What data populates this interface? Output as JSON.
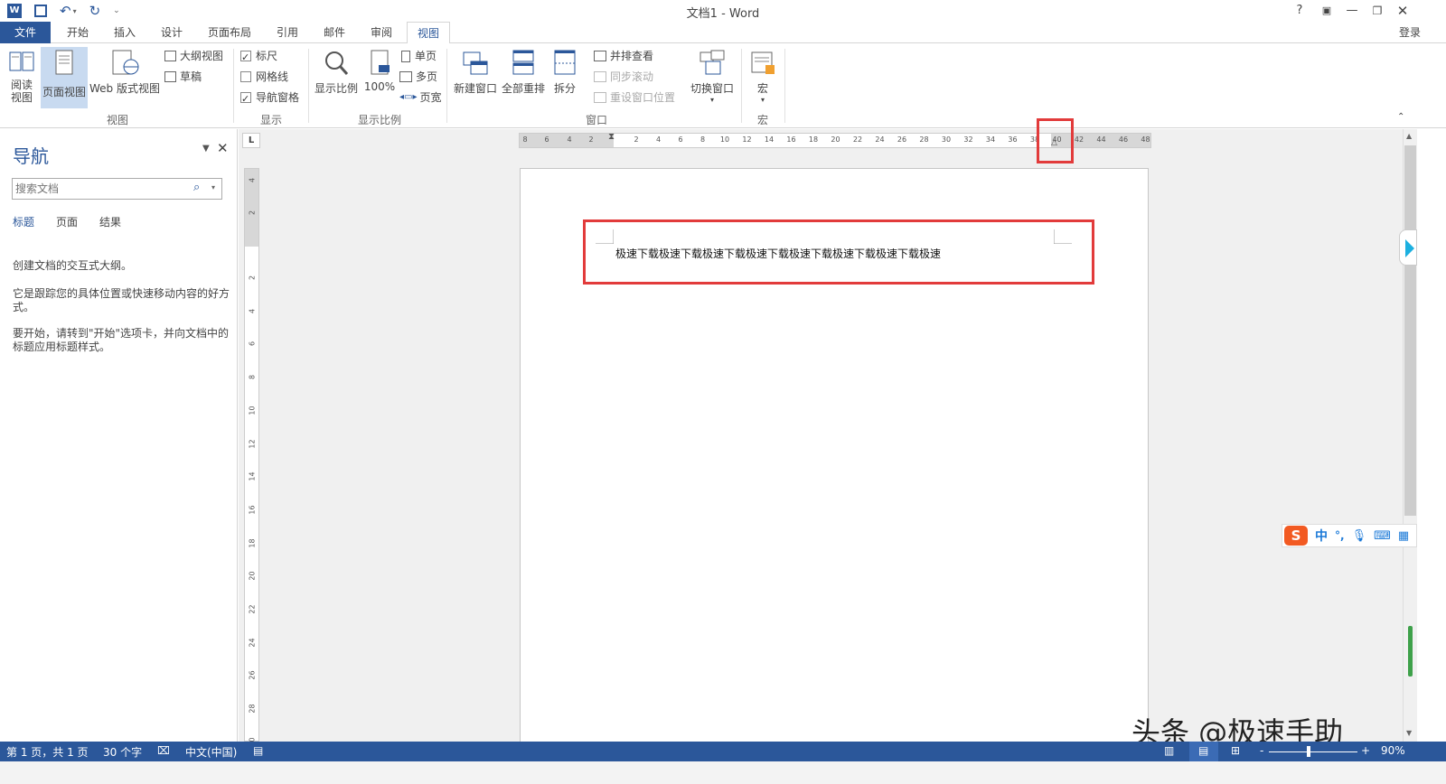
{
  "window": {
    "title": "文档1 - Word",
    "help": "?",
    "login": "登录"
  },
  "tabs": [
    {
      "label": "文件"
    },
    {
      "label": "开始"
    },
    {
      "label": "插入"
    },
    {
      "label": "设计"
    },
    {
      "label": "页面布局"
    },
    {
      "label": "引用"
    },
    {
      "label": "邮件"
    },
    {
      "label": "审阅"
    },
    {
      "label": "视图"
    }
  ],
  "ribbon": {
    "views": {
      "read": "阅读\n视图",
      "print_layout": "页面视图",
      "web": "Web 版式视图",
      "outline": "大纲视图",
      "draft": "草稿",
      "group": "视图"
    },
    "show": {
      "ruler": "标尺",
      "ruler_checked": true,
      "gridlines": "网格线",
      "gridlines_checked": false,
      "nav_pane": "导航窗格",
      "nav_pane_checked": true,
      "group": "显示"
    },
    "zoom": {
      "zoom": "显示比例",
      "hundred": "100%",
      "one_page": "单页",
      "multi_page": "多页",
      "page_width": "页宽",
      "group": "显示比例"
    },
    "window": {
      "new_window": "新建窗口",
      "arrange_all": "全部重排",
      "split": "拆分",
      "side_by_side": "并排查看",
      "sync_scroll": "同步滚动",
      "reset_position": "重设窗口位置",
      "switch_windows": "切换窗口",
      "group": "窗口"
    },
    "macros": {
      "macros": "宏",
      "group": "宏"
    }
  },
  "nav_pane": {
    "title": "导航",
    "search_placeholder": "搜索文档",
    "tabs": [
      "标题",
      "页面",
      "结果"
    ],
    "text1": "创建文档的交互式大纲。",
    "text2": "它是跟踪您的具体位置或快速移动内容的好方式。",
    "text3": "要开始，请转到\"开始\"选项卡，并向文档中的标题应用标题样式。"
  },
  "ruler": {
    "corner": "L",
    "h_left": [
      "8",
      "6",
      "4",
      "2"
    ],
    "h_right": [
      "2",
      "4",
      "6",
      "8",
      "10",
      "12",
      "14",
      "16",
      "18",
      "20",
      "22",
      "24",
      "26",
      "28",
      "30",
      "32",
      "34",
      "36",
      "38",
      "40",
      "42",
      "44",
      "46",
      "48"
    ],
    "v_top": [
      "4",
      "2"
    ],
    "v_body": [
      "2",
      "4",
      "6",
      "8",
      "10",
      "12",
      "14",
      "16",
      "18",
      "20",
      "22",
      "24",
      "26",
      "28",
      "30"
    ]
  },
  "document": {
    "text": "极速下载极速下载极速下载极速下载极速下载极速下载极速下载极速"
  },
  "status": {
    "page": "第 1 页，共 1 页",
    "words": "30 个字",
    "language": "中文(中国)",
    "zoom": "90%",
    "zoom_minus": "-",
    "zoom_plus": "+"
  },
  "ime": {
    "mode": "中",
    "punct": "°,"
  },
  "watermark": "头条 @极速手助",
  "colors": {
    "accent": "#2b579a",
    "highlight_box": "#e23b3b"
  }
}
